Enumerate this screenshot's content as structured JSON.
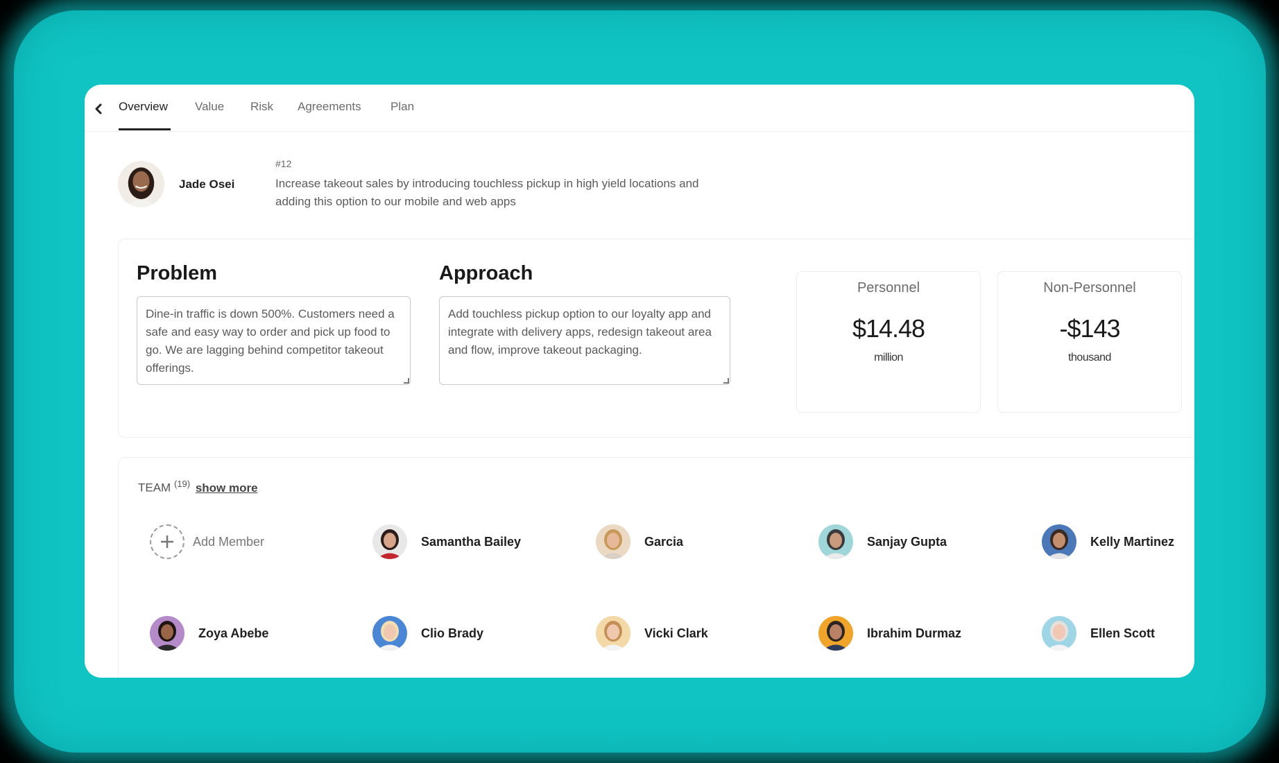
{
  "tabs": [
    "Overview",
    "Value",
    "Risk",
    "Agreements",
    "Plan"
  ],
  "active_tab": "Overview",
  "header": {
    "author": "Jade Osei",
    "ticket_number": "#12",
    "description": "Increase takeout sales by introducing touchless pickup in high yield locations and adding this option to our mobile and web apps"
  },
  "problem": {
    "title": "Problem",
    "text": "Dine-in traffic is down 500%. Customers need a safe and easy way to order and pick up food to go. We are lagging behind competitor takeout offerings."
  },
  "approach": {
    "title": "Approach",
    "text": "Add touchless pickup option to our loyalty app and integrate with delivery apps, redesign takeout area and flow, improve takeout packaging."
  },
  "metrics": [
    {
      "label": "Personnel",
      "value": "$14.48",
      "unit": "million"
    },
    {
      "label": "Non-Personnel",
      "value": "-$143",
      "unit": "thousand"
    }
  ],
  "team": {
    "label": "TEAM",
    "count": "(19)",
    "show_more": "show more",
    "add_member": "Add Member",
    "members": [
      {
        "name": "Samantha Bailey",
        "bg": "#e8e8e8",
        "skin": "#d9a58a",
        "hair": "#2a1c18",
        "shirt": "#c4262e"
      },
      {
        "name": "Garcia",
        "bg": "#ecd9c4",
        "skin": "#e8b89a",
        "hair": "#c89a5a",
        "shirt": "#d8d0c4"
      },
      {
        "name": "Sanjay Gupta",
        "bg": "#9fd6d9",
        "skin": "#c99a7e",
        "hair": "#3a3a3a",
        "shirt": "#eaeaea"
      },
      {
        "name": "Kelly Martinez",
        "bg": "#4a78b8",
        "skin": "#c48f6e",
        "hair": "#3b2a22",
        "shirt": "#e4e4e4"
      },
      {
        "name": "Zoya Abebe",
        "bg": "#b48ac9",
        "skin": "#9a6548",
        "hair": "#1e1410",
        "shirt": "#2a2a2a"
      },
      {
        "name": "Clio Brady",
        "bg": "#4a86d6",
        "skin": "#f0c8b0",
        "hair": "#f1ddb0",
        "shirt": "#f2f2f2"
      },
      {
        "name": "Vicki Clark",
        "bg": "#f4d9a8",
        "skin": "#f0c8ae",
        "hair": "#c49058",
        "shirt": "#f4f4f4"
      },
      {
        "name": "Ibrahim Durmaz",
        "bg": "#f0a52a",
        "skin": "#b98266",
        "hair": "#2c2420",
        "shirt": "#2c3c5a"
      },
      {
        "name": "Ellen Scott",
        "bg": "#9fd6e6",
        "skin": "#f0c8b4",
        "hair": "#e6e0da",
        "shirt": "#f4f4f4"
      }
    ]
  },
  "colors": {
    "accent_frame": "#10c4c4",
    "card_bg": "#ffffff"
  }
}
